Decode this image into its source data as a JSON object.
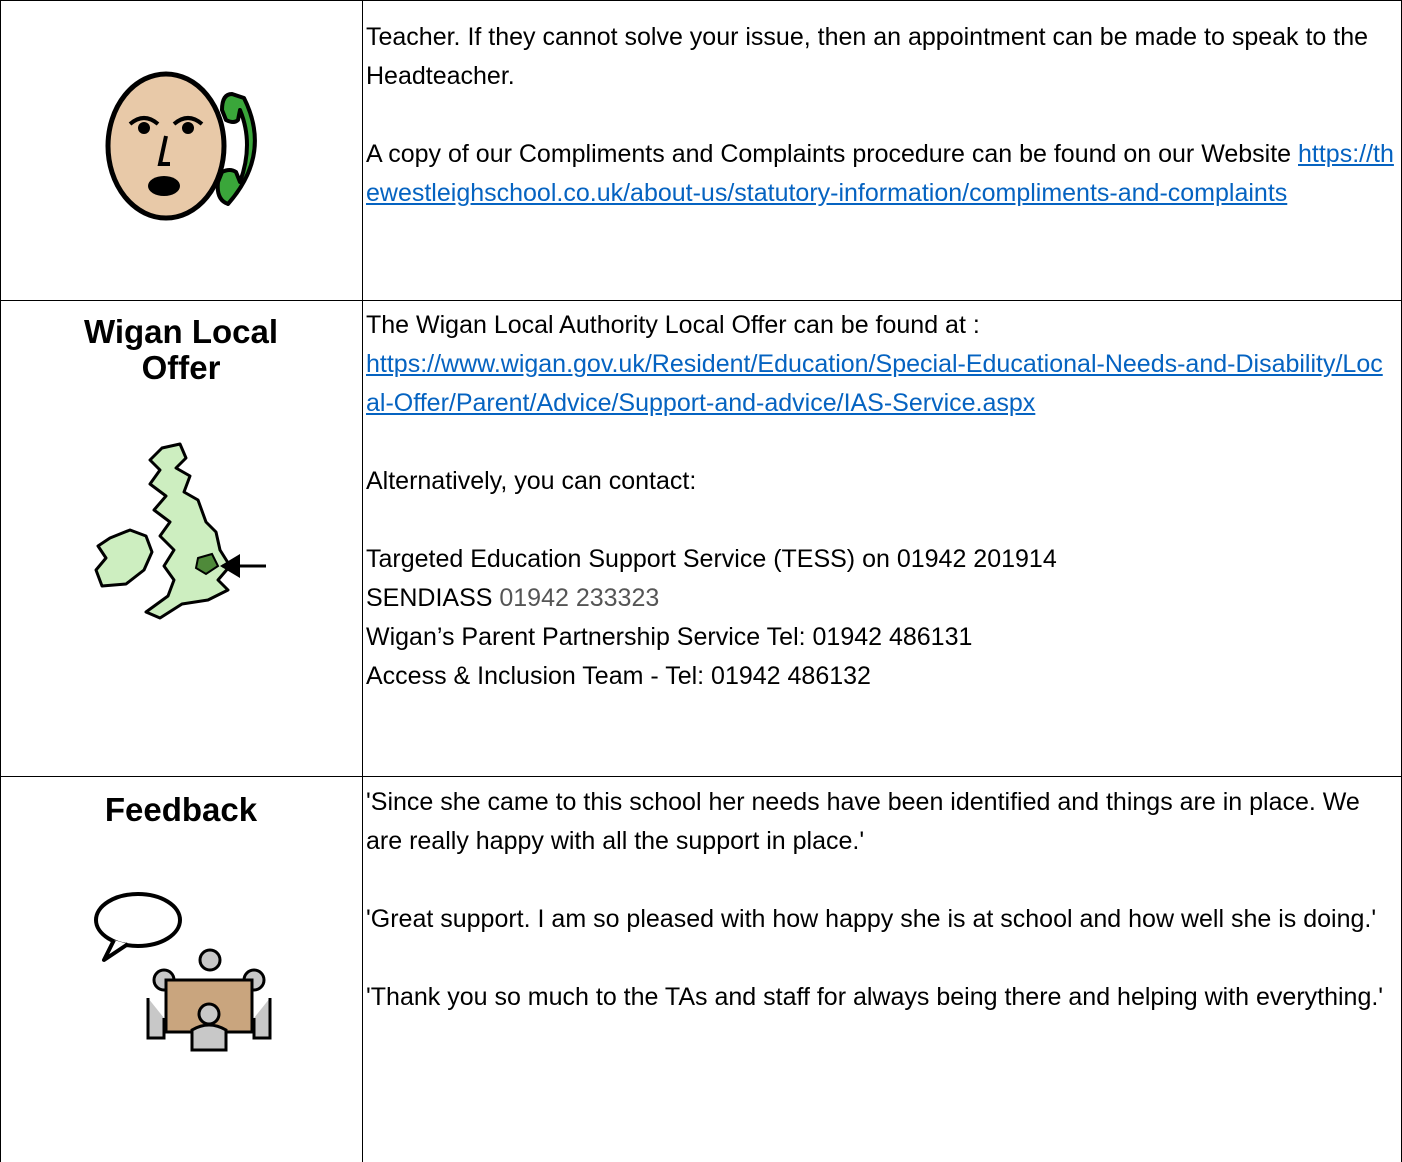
{
  "row1": {
    "para1": "Teacher.  If they cannot solve your issue, then an appointment can be made to speak to the Headteacher.",
    "para2_prefix": "A copy of our Compliments and Complaints procedure can be found on our Website ",
    "para2_link": "https://thewestleighschool.co.uk/about-us/statutory-information/compliments-and-complaints",
    "icon": "phone-call-face-icon"
  },
  "row2": {
    "heading": "Wigan Local Offer",
    "intro": "The Wigan Local Authority Local Offer can be found at :",
    "link": "https://www.wigan.gov.uk/Resident/Education/Special-Educational-Needs-and-Disability/Local-Offer/Parent/Advice/Support-and-advice/IAS-Service.aspx",
    "alt": "Alternatively, you can contact:",
    "contact1": "Targeted Education Support Service (TESS) on 01942 201914",
    "contact2_label": "SENDIASS ",
    "contact2_number": "01942 233323",
    "contact3": "Wigan’s Parent Partnership Service Tel: 01942 486131",
    "contact4": "Access & Inclusion Team - Tel: 01942 486132",
    "icon": "uk-map-icon"
  },
  "row3": {
    "heading": "Feedback",
    "quote1": "'Since she came to this school her needs have been identified and things are in place. We are really happy with all the support in place.'",
    "quote2": "'Great support. I am so pleased with how happy she is at school and how well she is doing.'",
    "quote3": "'Thank you so much to the TAs and staff for always being there and helping with everything.'",
    "icon": "meeting-speech-icon"
  },
  "colors": {
    "link": "#0563c1",
    "phone": "#3aa63a",
    "face": "#e8c9a8",
    "map": "#cdeec0"
  }
}
